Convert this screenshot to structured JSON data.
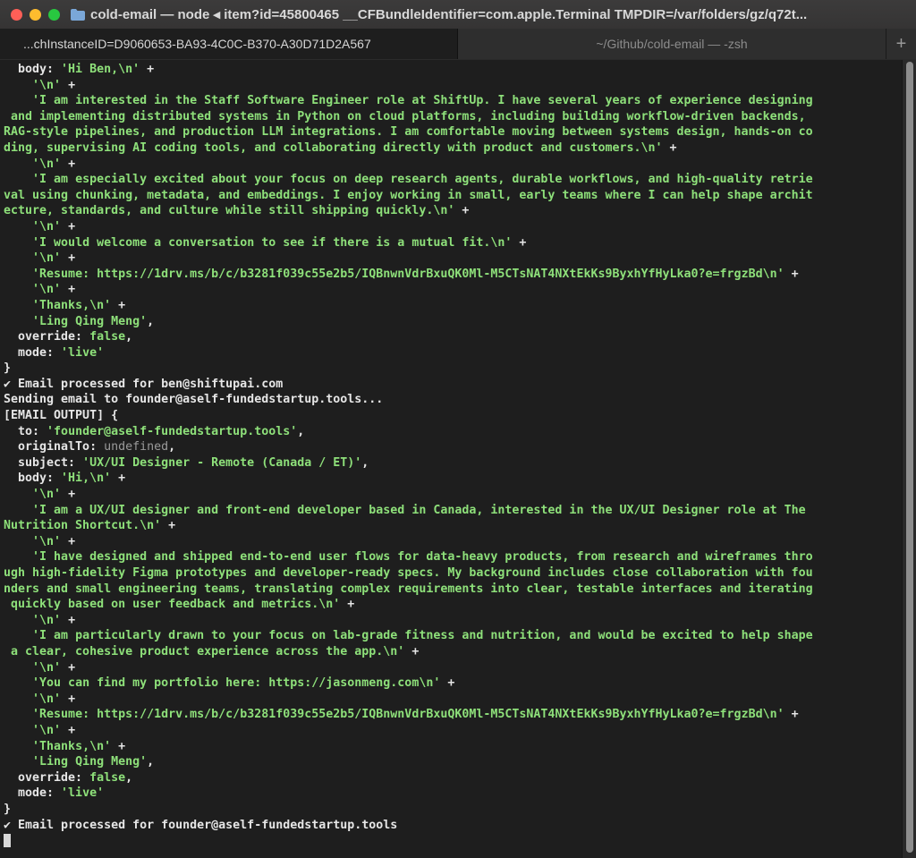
{
  "window": {
    "title": "cold-email — node ◂ item?id=45800465 __CFBundleIdentifier=com.apple.Terminal TMPDIR=/var/folders/gz/q72t..."
  },
  "tabs": [
    {
      "label": "...chInstanceID=D9060653-BA93-4C0C-B370-A30D71D2A567"
    },
    {
      "label": "~/Github/cold-email — -zsh"
    }
  ],
  "tab_add_label": "+",
  "terminal": {
    "lines": [
      [
        {
          "t": "  body: "
        },
        {
          "t": "'Hi Ben,\\n'",
          "c": "str"
        },
        {
          "t": " +"
        }
      ],
      [
        {
          "t": "    "
        },
        {
          "t": "'\\n'",
          "c": "str"
        },
        {
          "t": " +"
        }
      ],
      [
        {
          "t": "    "
        },
        {
          "t": "'I am interested in the Staff Software Engineer role at ShiftUp. I have several years of experience designing",
          "c": "str"
        }
      ],
      [
        {
          "t": " and implementing distributed systems in Python on cloud platforms, including building workflow-driven backends,",
          "c": "str"
        }
      ],
      [
        {
          "t": "RAG-style pipelines, and production LLM integrations. I am comfortable moving between systems design, hands-on co",
          "c": "str"
        }
      ],
      [
        {
          "t": "ding, supervising AI coding tools, and collaborating directly with product and customers.\\n'",
          "c": "str"
        },
        {
          "t": " +"
        }
      ],
      [
        {
          "t": "    "
        },
        {
          "t": "'\\n'",
          "c": "str"
        },
        {
          "t": " +"
        }
      ],
      [
        {
          "t": "    "
        },
        {
          "t": "'I am especially excited about your focus on deep research agents, durable workflows, and high-quality retrie",
          "c": "str"
        }
      ],
      [
        {
          "t": "val using chunking, metadata, and embeddings. I enjoy working in small, early teams where I can help shape archit",
          "c": "str"
        }
      ],
      [
        {
          "t": "ecture, standards, and culture while still shipping quickly.\\n'",
          "c": "str"
        },
        {
          "t": " +"
        }
      ],
      [
        {
          "t": "    "
        },
        {
          "t": "'\\n'",
          "c": "str"
        },
        {
          "t": " +"
        }
      ],
      [
        {
          "t": "    "
        },
        {
          "t": "'I would welcome a conversation to see if there is a mutual fit.\\n'",
          "c": "str"
        },
        {
          "t": " +"
        }
      ],
      [
        {
          "t": "    "
        },
        {
          "t": "'\\n'",
          "c": "str"
        },
        {
          "t": " +"
        }
      ],
      [
        {
          "t": "    "
        },
        {
          "t": "'Resume: https://1drv.ms/b/c/b3281f039c55e2b5/IQBnwnVdrBxuQK0Ml-M5CTsNAT4NXtEkKs9ByxhYfHyLka0?e=frgzBd\\n'",
          "c": "str"
        },
        {
          "t": " +"
        }
      ],
      [
        {
          "t": "    "
        },
        {
          "t": "'\\n'",
          "c": "str"
        },
        {
          "t": " +"
        }
      ],
      [
        {
          "t": "    "
        },
        {
          "t": "'Thanks,\\n'",
          "c": "str"
        },
        {
          "t": " +"
        }
      ],
      [
        {
          "t": "    "
        },
        {
          "t": "'Ling Qing Meng'",
          "c": "str"
        },
        {
          "t": ","
        }
      ],
      [
        {
          "t": "  override: "
        },
        {
          "t": "false",
          "c": "str"
        },
        {
          "t": ","
        }
      ],
      [
        {
          "t": "  mode: "
        },
        {
          "t": "'live'",
          "c": "str"
        }
      ],
      [
        {
          "t": "}"
        }
      ],
      [
        {
          "t": "✔ Email processed for ben@shiftupai.com"
        }
      ],
      [
        {
          "t": "Sending email to founder@aself-fundedstartup.tools..."
        }
      ],
      [
        {
          "t": "[EMAIL OUTPUT] {"
        }
      ],
      [
        {
          "t": "  to: "
        },
        {
          "t": "'founder@aself-fundedstartup.tools'",
          "c": "str"
        },
        {
          "t": ","
        }
      ],
      [
        {
          "t": "  originalTo: "
        },
        {
          "t": "undefined",
          "c": "undef"
        },
        {
          "t": ","
        }
      ],
      [
        {
          "t": "  subject: "
        },
        {
          "t": "'UX/UI Designer - Remote (Canada / ET)'",
          "c": "str"
        },
        {
          "t": ","
        }
      ],
      [
        {
          "t": "  body: "
        },
        {
          "t": "'Hi,\\n'",
          "c": "str"
        },
        {
          "t": " +"
        }
      ],
      [
        {
          "t": "    "
        },
        {
          "t": "'\\n'",
          "c": "str"
        },
        {
          "t": " +"
        }
      ],
      [
        {
          "t": "    "
        },
        {
          "t": "'I am a UX/UI designer and front-end developer based in Canada, interested in the UX/UI Designer role at The",
          "c": "str"
        }
      ],
      [
        {
          "t": "Nutrition Shortcut.\\n'",
          "c": "str"
        },
        {
          "t": " +"
        }
      ],
      [
        {
          "t": "    "
        },
        {
          "t": "'\\n'",
          "c": "str"
        },
        {
          "t": " +"
        }
      ],
      [
        {
          "t": "    "
        },
        {
          "t": "'I have designed and shipped end-to-end user flows for data-heavy products, from research and wireframes thro",
          "c": "str"
        }
      ],
      [
        {
          "t": "ugh high-fidelity Figma prototypes and developer-ready specs. My background includes close collaboration with fou",
          "c": "str"
        }
      ],
      [
        {
          "t": "nders and small engineering teams, translating complex requirements into clear, testable interfaces and iterating",
          "c": "str"
        }
      ],
      [
        {
          "t": " quickly based on user feedback and metrics.\\n'",
          "c": "str"
        },
        {
          "t": " +"
        }
      ],
      [
        {
          "t": "    "
        },
        {
          "t": "'\\n'",
          "c": "str"
        },
        {
          "t": " +"
        }
      ],
      [
        {
          "t": "    "
        },
        {
          "t": "'I am particularly drawn to your focus on lab-grade fitness and nutrition, and would be excited to help shape",
          "c": "str"
        }
      ],
      [
        {
          "t": " a clear, cohesive product experience across the app.\\n'",
          "c": "str"
        },
        {
          "t": " +"
        }
      ],
      [
        {
          "t": "    "
        },
        {
          "t": "'\\n'",
          "c": "str"
        },
        {
          "t": " +"
        }
      ],
      [
        {
          "t": "    "
        },
        {
          "t": "'You can find my portfolio here: https://jasonmeng.com\\n'",
          "c": "str"
        },
        {
          "t": " +"
        }
      ],
      [
        {
          "t": "    "
        },
        {
          "t": "'\\n'",
          "c": "str"
        },
        {
          "t": " +"
        }
      ],
      [
        {
          "t": "    "
        },
        {
          "t": "'Resume: https://1drv.ms/b/c/b3281f039c55e2b5/IQBnwnVdrBxuQK0Ml-M5CTsNAT4NXtEkKs9ByxhYfHyLka0?e=frgzBd\\n'",
          "c": "str"
        },
        {
          "t": " +"
        }
      ],
      [
        {
          "t": "    "
        },
        {
          "t": "'\\n'",
          "c": "str"
        },
        {
          "t": " +"
        }
      ],
      [
        {
          "t": "    "
        },
        {
          "t": "'Thanks,\\n'",
          "c": "str"
        },
        {
          "t": " +"
        }
      ],
      [
        {
          "t": "    "
        },
        {
          "t": "'Ling Qing Meng'",
          "c": "str"
        },
        {
          "t": ","
        }
      ],
      [
        {
          "t": "  override: "
        },
        {
          "t": "false",
          "c": "str"
        },
        {
          "t": ","
        }
      ],
      [
        {
          "t": "  mode: "
        },
        {
          "t": "'live'",
          "c": "str"
        }
      ],
      [
        {
          "t": "}"
        }
      ],
      [
        {
          "t": "✔ Email processed for founder@aself-fundedstartup.tools"
        }
      ]
    ]
  },
  "colors": {
    "string": "#8ee07a",
    "text": "#e6e6e6",
    "background": "#1e1e1e"
  },
  "icons": {
    "folder": "folder-icon",
    "add_tab": "plus-icon"
  }
}
